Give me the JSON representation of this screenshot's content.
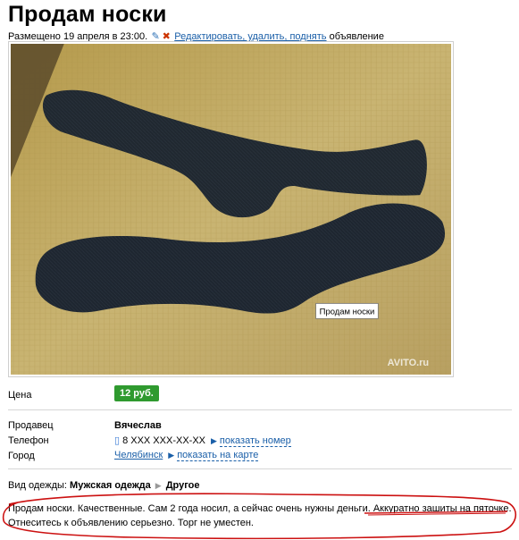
{
  "title": "Продам носки",
  "meta": {
    "posted": "Размещено 19 апреля в 23:00.",
    "edit_links": "Редактировать, удалить, поднять",
    "suffix": "объявление"
  },
  "photo": {
    "tooltip": "Продам носки",
    "watermark": "AVITO.ru"
  },
  "price": {
    "label": "Цена",
    "value": "12 руб."
  },
  "seller": {
    "label": "Продавец",
    "value": "Вячеслав"
  },
  "phone": {
    "label": "Телефон",
    "value": "8 XXX XXX-XX-XX",
    "show_link": "показать номер"
  },
  "city": {
    "label": "Город",
    "value": "Челябинск",
    "map_link": "показать на карте"
  },
  "category": {
    "label": "Вид одежды:",
    "value": "Мужская одежда",
    "sub": "Другое"
  },
  "description": {
    "part1": "Продам носки. Качественные. Сам 2 года носил, а сейчас очень нужны деньги. ",
    "highlight": "Аккуратно зашиты на пяточке.",
    "line2": "Отнеситесь к объявлению серьезно. Торг не уместен."
  },
  "colors": {
    "price_green": "#2f9a2f",
    "link_blue": "#1a5fa8",
    "annotation_red": "#cc1111"
  }
}
